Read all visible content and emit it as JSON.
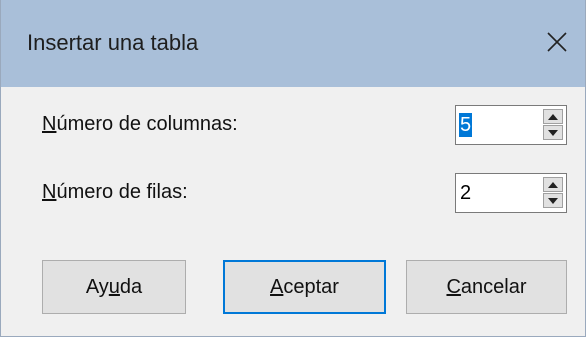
{
  "dialog": {
    "title": "Insertar una tabla",
    "close_icon": "close-icon"
  },
  "fields": {
    "columns": {
      "label_mnemonic": "N",
      "label_rest": "úmero de columnas:",
      "value": "5"
    },
    "rows": {
      "label_mnemonic": "N",
      "label_rest": "úmero de filas:",
      "value": "2"
    }
  },
  "buttons": {
    "help": {
      "pre": "Ay",
      "mnemonic": "u",
      "post": "da"
    },
    "ok": {
      "pre": "",
      "mnemonic": "A",
      "post": "ceptar"
    },
    "cancel": {
      "pre": "",
      "mnemonic": "C",
      "post": "ancelar"
    }
  },
  "colors": {
    "titlebar": "#a9bfd9",
    "accent": "#0078d7"
  }
}
